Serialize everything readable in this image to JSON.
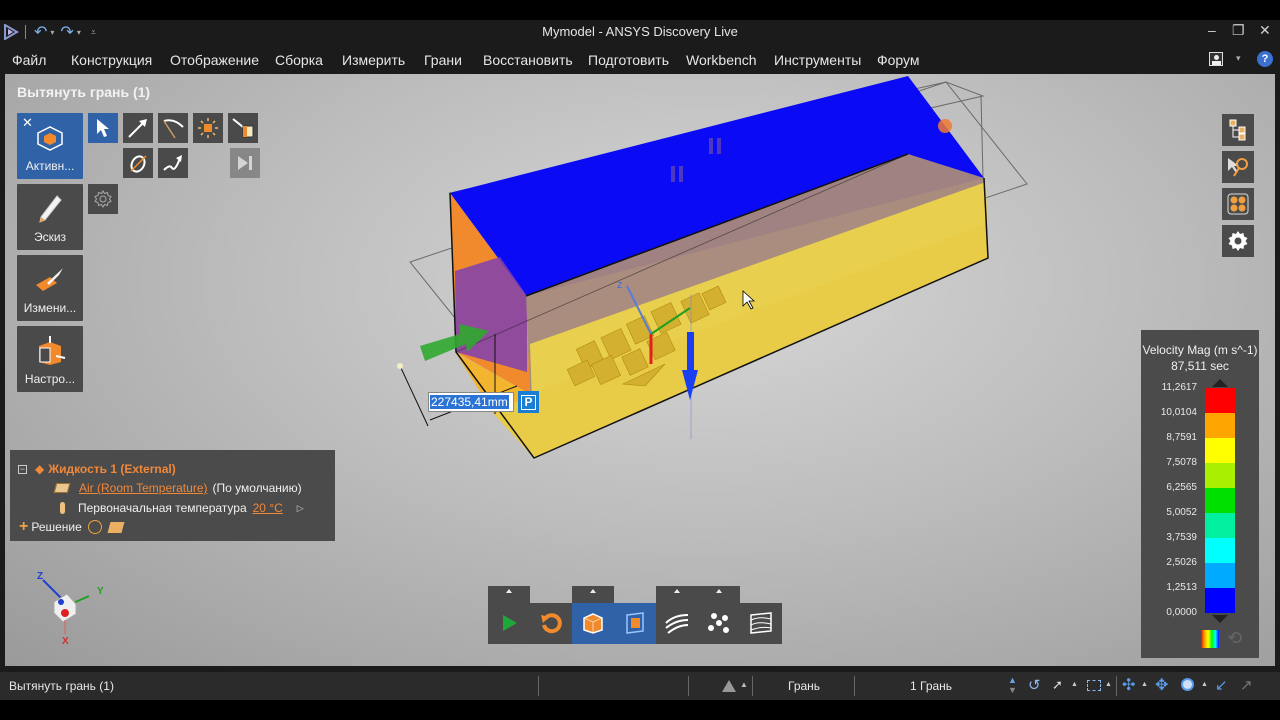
{
  "window": {
    "title": "Mymodel - ANSYS Discovery Live",
    "quick_access": [
      "undo-icon",
      "redo-icon",
      "customize-icon"
    ],
    "controls": {
      "minimize": "–",
      "restore": "❐",
      "close": "✕"
    }
  },
  "menu": {
    "items": [
      "Файл",
      "Конструкция",
      "Отображение",
      "Сборка",
      "Измерить",
      "Грани",
      "Восстановить",
      "Подготовить",
      "Workbench",
      "Инструменты",
      "Форум"
    ]
  },
  "tool_panel": {
    "title": "Вытянуть грань (1)",
    "main_tiles": [
      {
        "label": "Активн...",
        "icon": "active-body-icon",
        "active": true
      },
      {
        "label": "Эскиз",
        "icon": "pencil-icon",
        "active": false
      },
      {
        "label": "Измени...",
        "icon": "modify-arrow-icon",
        "active": false
      },
      {
        "label": "Настро...",
        "icon": "setup-icon",
        "active": false
      }
    ],
    "close_symbol": "✕",
    "options": [
      "select-arrow-icon",
      "direction-arrow-icon",
      "pickaxe-icon",
      "sun-face-icon",
      "pull-to-body-icon",
      "revolve-icon",
      "sweep-icon",
      "complete-icon"
    ],
    "settings_icon": "gear-icon"
  },
  "tree": {
    "fluid": "Жидкость 1 (External)",
    "material_link": "Air (Room Temperature)",
    "material_note": "(По умолчанию)",
    "temp_label": "Первоначальная температура",
    "temp_value": "20 °C",
    "solution": "Решение"
  },
  "dimension": {
    "value": "227435,41mm",
    "badge": "P"
  },
  "legend": {
    "title": "Velocity Mag (m s^-1)",
    "time": "87,511 sec",
    "values": [
      "11,2617",
      "10,0104",
      "8,7591",
      "7,5078",
      "6,2565",
      "5,0052",
      "3,7539",
      "2,5026",
      "1,2513",
      "0,0000"
    ],
    "colors": [
      "#ff0000",
      "#ffa500",
      "#ffff00",
      "#a8f000",
      "#00e000",
      "#00f0a0",
      "#00ffff",
      "#00aaff",
      "#0000ff"
    ]
  },
  "right_tools": [
    "structure-tree-icon",
    "select-pin-icon",
    "groups-icon",
    "settings-gear-icon"
  ],
  "bottom_toolbar": [
    "play-icon",
    "reset-icon",
    "solid-view-icon",
    "face-view-icon",
    "streamlines-icon",
    "particles-icon",
    "contour-icon"
  ],
  "axis": {
    "x": "X",
    "y": "Y",
    "z": "Z"
  },
  "status": {
    "left": "Вытянуть грань (1)",
    "mode": "Грань",
    "count": "1 Грань"
  }
}
